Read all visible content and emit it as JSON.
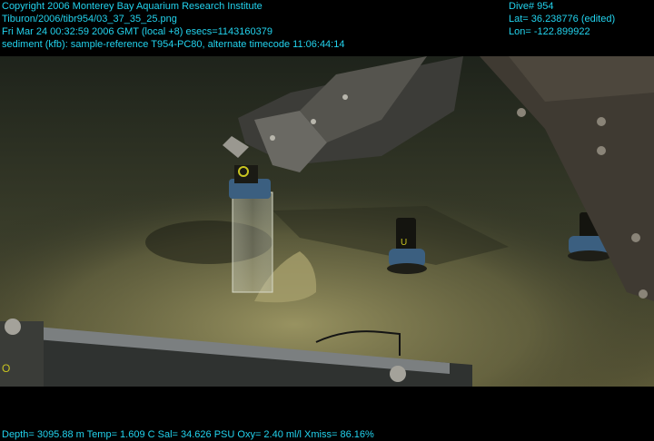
{
  "header_left": {
    "copyright": "Copyright 2006 Monterey Bay Aquarium Research Institute",
    "path": "Tiburon/2006/tibr954/03_37_35_25.png",
    "datetime": "Fri Mar 24 00:32:59 2006 GMT (local +8)  esecs=1143160379",
    "sediment": "sediment (kfb): sample-reference T954-PC80, alternate timecode 11:06:44:14"
  },
  "header_right": {
    "dive": "Dive# 954",
    "lat": "Lat= 36.238776 (edited)",
    "lon": "Lon= -122.899922"
  },
  "footer": {
    "readout": "Depth= 3095.88 m  Temp= 1.609 C  Sal= 34.626 PSU  Oxy= 2.40 ml/l  Xmiss= 86.16%"
  },
  "colors": {
    "overlay_text": "#22d3ee",
    "seafloor": "#7a7648",
    "water": "#2b3024"
  }
}
